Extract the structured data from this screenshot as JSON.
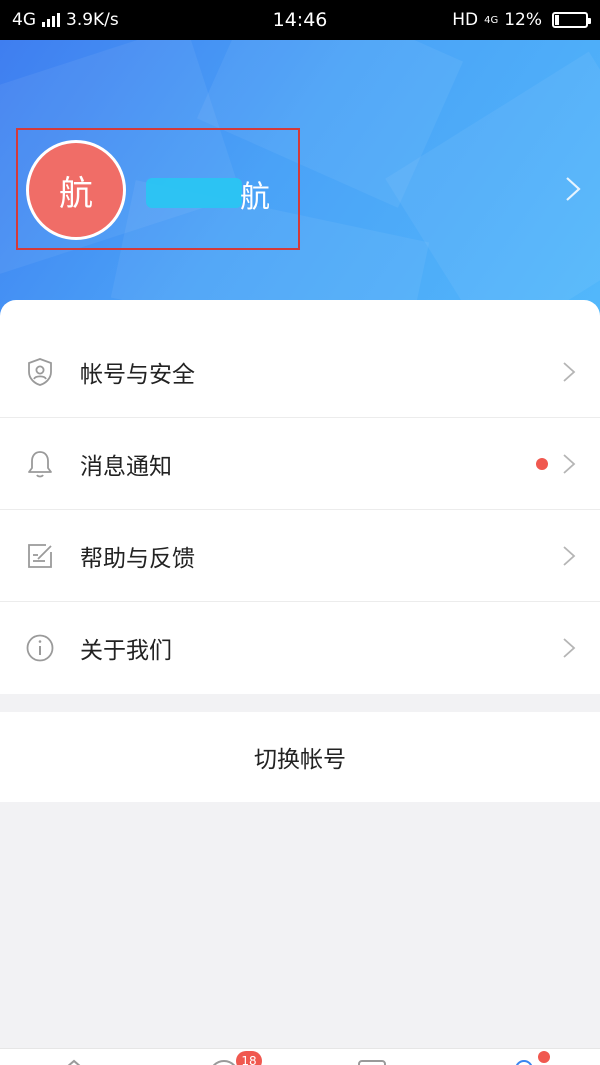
{
  "status_bar": {
    "network": "4G",
    "speed": "3.9K/s",
    "time": "14:46",
    "hd": "HD",
    "sub_network": "4G",
    "battery": "12%",
    "battery_level": 0.12
  },
  "profile": {
    "avatar_char": "航",
    "name": "航"
  },
  "menu": {
    "items": [
      {
        "label": "帐号与安全",
        "icon": "shield-user-icon",
        "has_dot": false
      },
      {
        "label": "消息通知",
        "icon": "bell-icon",
        "has_dot": true
      },
      {
        "label": "帮助与反馈",
        "icon": "edit-note-icon",
        "has_dot": false
      },
      {
        "label": "关于我们",
        "icon": "info-icon",
        "has_dot": false
      }
    ]
  },
  "switch_account": {
    "label": "切换帐号"
  },
  "bottom_nav": {
    "badge_count": "18"
  },
  "colors": {
    "header_gradient_start": "#3f7ef0",
    "header_gradient_end": "#52b8fb",
    "avatar_bg": "#f06d67",
    "highlight_box": "#d33a3a",
    "notification_dot": "#f0584f"
  }
}
